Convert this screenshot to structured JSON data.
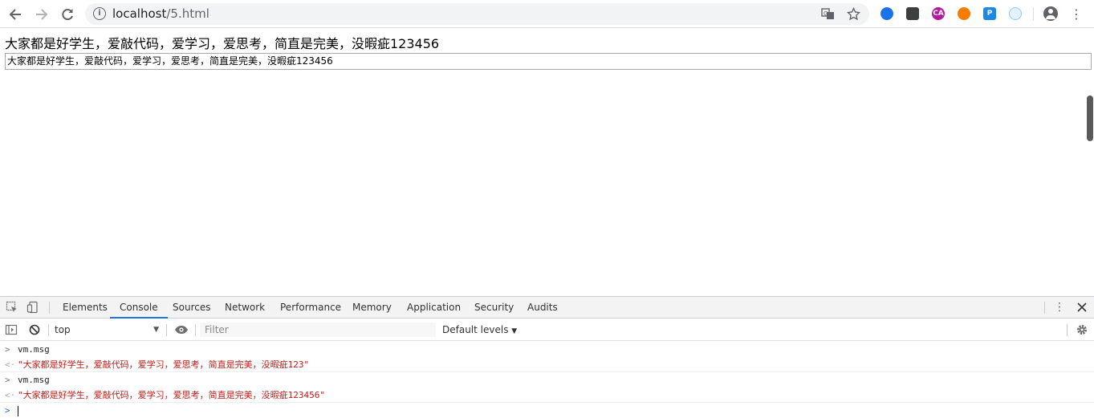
{
  "browser": {
    "url_host": "localhost",
    "url_path": "/5.html",
    "icons": {
      "back": "arrow-back-icon",
      "forward": "arrow-forward-icon",
      "reload": "reload-icon",
      "info": "info-icon",
      "translate": "translate-icon",
      "bookmark": "star-icon",
      "account": "account-icon",
      "menu": "more-vert-icon"
    },
    "extensions": [
      {
        "name": "extension-globe",
        "color": "#1a73e8",
        "label": ""
      },
      {
        "name": "extension-dark",
        "color": "#3c4043",
        "label": ""
      },
      {
        "name": "extension-ca",
        "color": "#b5179e",
        "label": "CA"
      },
      {
        "name": "extension-orange",
        "color": "#f57c00",
        "label": ""
      },
      {
        "name": "extension-p",
        "color": "#1e88e5",
        "label": "P"
      },
      {
        "name": "extension-bird",
        "color": "#90caf9",
        "label": ""
      }
    ]
  },
  "page": {
    "heading": "大家都是好学生，爱敲代码，爱学习，爱思考，简直是完美，没暇疵123456",
    "input_value": "大家都是好学生，爱敲代码，爱学习，爱思考，简直是完美，没暇疵123456"
  },
  "devtools": {
    "tabs": [
      "Elements",
      "Console",
      "Sources",
      "Network",
      "Performance",
      "Memory",
      "Application",
      "Security",
      "Audits"
    ],
    "active_tab": "Console",
    "context": "top",
    "filter_placeholder": "Filter",
    "levels_label": "Default levels",
    "levels_arrow": "▼",
    "console_lines": [
      {
        "type": "input",
        "text": "vm.msg"
      },
      {
        "type": "result",
        "text": "\"大家都是好学生，爱敲代码，爱学习，爱思考，简直是完美，没暇疵123\""
      },
      {
        "type": "input",
        "text": "vm.msg"
      },
      {
        "type": "result",
        "text": "\"大家都是好学生，爱敲代码，爱学习，爱思考，简直是完美，没暇疵123456\""
      }
    ]
  },
  "colors": {
    "accent": "#1a73e8",
    "string_result": "#c41a16"
  }
}
